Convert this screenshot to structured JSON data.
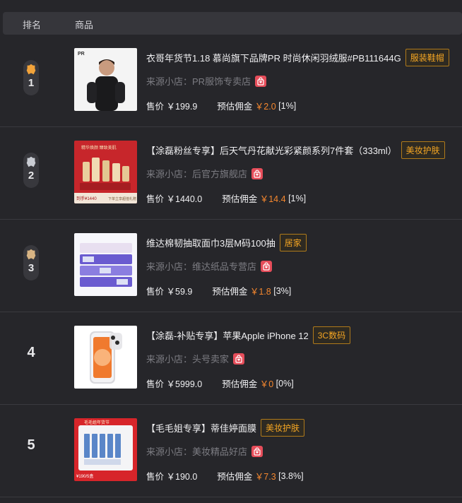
{
  "header": {
    "rank_label": "排名",
    "product_label": "商品"
  },
  "rows": [
    {
      "rank": "1",
      "title": "衣哥年货节1.18 慕尚旗下品牌PR 时尚休闲羽绒服#PB111644G",
      "tag": "服装鞋帽",
      "shop_prefix": "来源小店：",
      "shop": "PR服饰专卖店",
      "price_label": "售价",
      "price": "￥199.9",
      "commission_label": "预估佣金",
      "commission": "￥2.0",
      "rate": "[1%]",
      "medal_color": "#f2a33a"
    },
    {
      "rank": "2",
      "title": "【涂磊粉丝专享】后天气丹花献光彩紧颜系列7件套（333ml）",
      "tag": "美妆护肤",
      "shop_prefix": "来源小店：",
      "shop": "后官方旗舰店",
      "price_label": "售价",
      "price": "￥1440.0",
      "commission_label": "预估佣金",
      "commission": "￥14.4",
      "rate": "[1%]",
      "medal_color": "#c9ccd3"
    },
    {
      "rank": "3",
      "title": "维达棉韧抽取面巾3层M码100抽",
      "tag": "居家",
      "shop_prefix": "来源小店：",
      "shop": "维达纸品专营店",
      "price_label": "售价",
      "price": "￥59.9",
      "commission_label": "预估佣金",
      "commission": "￥1.8",
      "rate": "[3%]",
      "medal_color": "#d8b483"
    },
    {
      "rank": "4",
      "title": "【涂磊-补贴专享】苹果Apple iPhone 12",
      "tag": "3C数码",
      "shop_prefix": "来源小店：",
      "shop": "头号卖家",
      "price_label": "售价",
      "price": "￥5999.0",
      "commission_label": "预估佣金",
      "commission": "￥0",
      "rate": "[0%]"
    },
    {
      "rank": "5",
      "title": "【毛毛姐专享】蒂佳婷面膜",
      "tag": "美妆护肤",
      "shop_prefix": "来源小店：",
      "shop": "美妆精品好店",
      "price_label": "售价",
      "price": "￥190.0",
      "commission_label": "预估佣金",
      "commission": "￥7.3",
      "rate": "[3.8%]"
    }
  ],
  "thumb_text": {
    "r2_banner": "精华焕颜 臻致美肌",
    "r2_price": "到手¥1440",
    "r2_sub": "下单立享超值礼赠",
    "r5_banner": "毛毛姐年货节",
    "r5_price": "¥190/5盒"
  },
  "icons": {
    "medal": "medal-icon",
    "shop": "shop-bag-icon"
  }
}
